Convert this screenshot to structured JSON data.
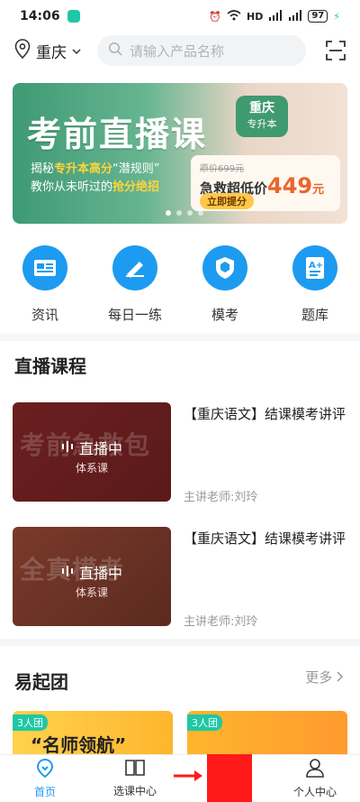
{
  "status": {
    "time": "14:06",
    "hd": "HD",
    "battery": "97"
  },
  "topbar": {
    "city": "重庆",
    "search_placeholder": "请输入产品名称"
  },
  "banner": {
    "title": "考前直播课",
    "tag_line1": "重庆",
    "tag_line2": "专升本",
    "line1_pre": "揭秘",
    "line1_hl": "专升本高分",
    "line1_post": "“潜规则”",
    "line2_pre": "教你从未听过的",
    "line2_hl": "抢分绝招",
    "orig_price": "原价699元",
    "deal_label": "急救超低价",
    "deal_price": "449",
    "deal_unit": "元",
    "button": "立即提分"
  },
  "quick": [
    {
      "label": "资讯",
      "icon": "news-icon"
    },
    {
      "label": "每日一练",
      "icon": "pen-icon"
    },
    {
      "label": "模考",
      "icon": "shield-icon"
    },
    {
      "label": "题库",
      "icon": "question-bank-icon"
    }
  ],
  "live_section": {
    "title": "直播课程"
  },
  "courses": [
    {
      "thumb_watermark": "考前急救包",
      "live_label": "直播中",
      "type": "体系课",
      "title": "【重庆语文】结课模考讲评",
      "teacher": "主讲老师:刘玲"
    },
    {
      "thumb_watermark": "全真模考",
      "live_label": "直播中",
      "type": "体系课",
      "title": "【重庆语文】结课模考讲评",
      "teacher": "主讲老师:刘玲"
    }
  ],
  "group_section": {
    "title": "易起团",
    "more": "更多"
  },
  "group_cards": [
    {
      "badge": "3人团",
      "text": "“名师领航”"
    },
    {
      "badge": "3人团",
      "text": ""
    }
  ],
  "tabs": [
    {
      "label": "首页",
      "icon": "home-icon",
      "active": true
    },
    {
      "label": "选课中心",
      "icon": "book-icon",
      "active": false
    },
    {
      "label": "",
      "icon": "",
      "active": false
    },
    {
      "label": "个人中心",
      "icon": "person-icon",
      "active": false
    }
  ]
}
